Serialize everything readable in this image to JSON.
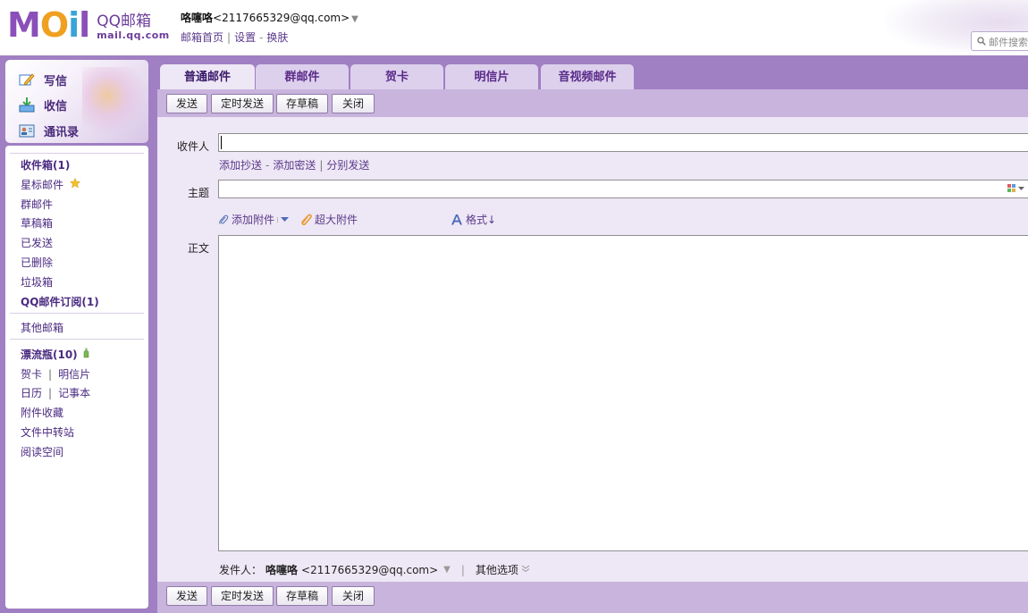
{
  "header": {
    "logo_word": "MOil",
    "logo_cn": "QQ邮箱",
    "logo_url": "mail.qq.com",
    "user_name": "咯噻咯",
    "user_email": "<2117665329@qq.com>",
    "user_dropdown": "▼",
    "links": [
      "邮箱首页",
      "设置",
      "换肤"
    ],
    "search_placeholder": "邮件搜索"
  },
  "sidebar": {
    "quick": [
      {
        "label": "写信",
        "icon": "pencil-icon"
      },
      {
        "label": "收信",
        "icon": "inbox-icon"
      },
      {
        "label": "通讯录",
        "icon": "contacts-icon"
      }
    ],
    "folders": {
      "inbox": "收件箱(1)",
      "starred": "星标邮件",
      "group": "群邮件",
      "drafts": "草稿箱",
      "sent": "已发送",
      "deleted": "已删除",
      "spam": "垃圾箱",
      "subscriptions": "QQ邮件订阅(1)",
      "other": "其他邮箱",
      "bottle": "漂流瓶(10)",
      "card": "贺卡",
      "postcard": "明信片",
      "calendar": "日历",
      "notes": "记事本",
      "attachments": "附件收藏",
      "transfer": "文件中转站",
      "reading": "阅读空间"
    }
  },
  "tabs": [
    "普通邮件",
    "群邮件",
    "贺卡",
    "明信片",
    "音视频邮件"
  ],
  "toolbar": {
    "send": "发送",
    "scheduled_send": "定时发送",
    "save_draft": "存草稿",
    "close": "关闭"
  },
  "compose": {
    "to_label": "收件人",
    "to_value": "",
    "add_cc": "添加抄送",
    "add_bcc": "添加密送",
    "separate_send": "分别发送",
    "subject_label": "主题",
    "subject_value": "",
    "add_attachment": "添加附件",
    "big_attachment": "超大附件",
    "format": "格式↓",
    "body_label": "正文",
    "body_value": "",
    "sender_label": "发件人：",
    "sender_name": "咯噻咯",
    "sender_email": "<2117665329@qq.com>",
    "other_options": "其他选项"
  },
  "colors": {
    "frame": "#a07fc3",
    "toolbar": "#c9b4de",
    "panel": "#eee7f5",
    "link": "#5a3a8a"
  }
}
